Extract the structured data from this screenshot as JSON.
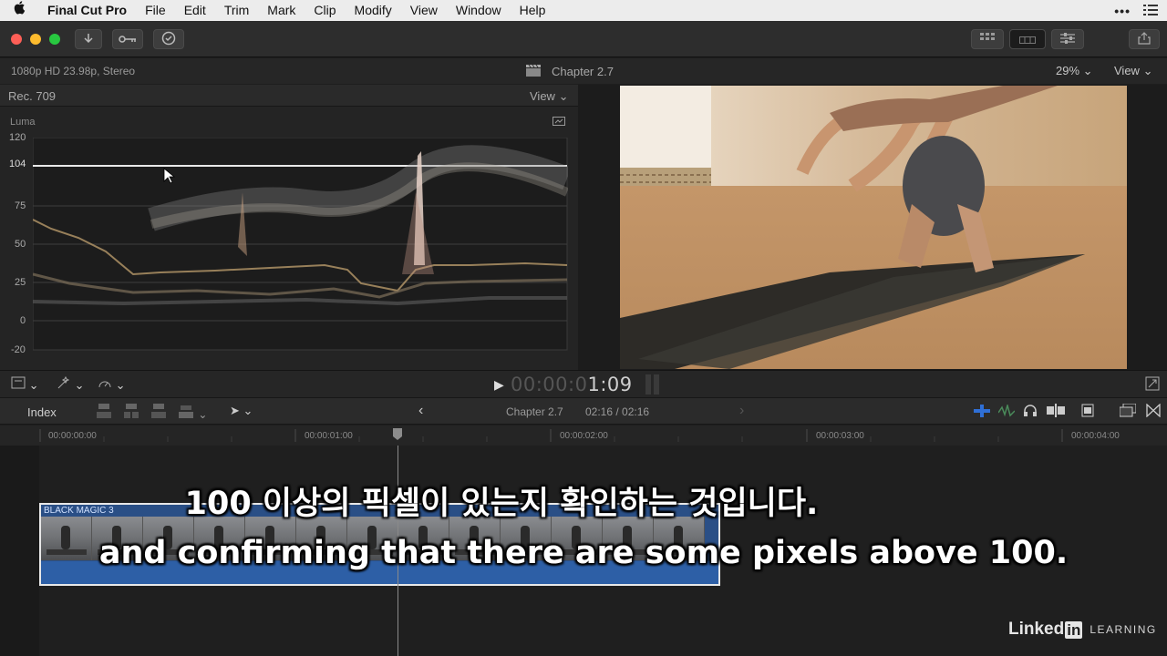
{
  "menubar": {
    "app": "Final Cut Pro",
    "items": [
      "File",
      "Edit",
      "Trim",
      "Mark",
      "Clip",
      "Modify",
      "View",
      "Window",
      "Help"
    ]
  },
  "viewer": {
    "format": "1080p HD 23.98p, Stereo",
    "project": "Chapter 2.7",
    "zoom": "29%",
    "view": "View"
  },
  "scope": {
    "colorspace": "Rec. 709",
    "view": "View",
    "mode": "Luma",
    "scale": [
      "120",
      "104",
      "75",
      "50",
      "25",
      "0",
      "-20"
    ]
  },
  "playback": {
    "timecode_dim": "00:00:0",
    "timecode": "1:09"
  },
  "timeline_bar": {
    "index": "Index",
    "project": "Chapter 2.7",
    "duration": "02:16 / 02:16"
  },
  "ruler": [
    "00:00:00:00",
    "00:00:01:00",
    "00:00:02:00",
    "00:00:03:00",
    "00:00:04:00"
  ],
  "clip": {
    "name": "BLACK MAGIC 3"
  },
  "subtitles": {
    "korean": "100 이상의 픽셀이 있는지 확인하는 것입니다.",
    "english": "and confirming that there are some pixels above 100."
  },
  "watermark": {
    "brand": "Linked",
    "in": "in",
    "learning": "LEARNING"
  },
  "colors": {
    "accent_blue": "#2f6fd6",
    "clip_blue": "#2a4f86",
    "playhead": "#9a9a9a"
  }
}
